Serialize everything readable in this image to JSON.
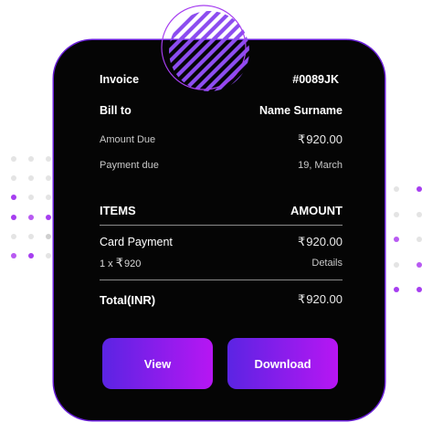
{
  "invoice": {
    "label": "Invoice",
    "number": "#0089JK",
    "bill_to_label": "Bill to",
    "bill_to_name": "Name Surname",
    "amount_due_label": "Amount Due",
    "amount_due_value": "920.00",
    "payment_due_label": "Payment due",
    "payment_due_value": "19, March"
  },
  "items": {
    "header_items": "ITEMS",
    "header_amount": "AMOUNT",
    "rows": [
      {
        "name": "Card Payment",
        "amount": "920.00",
        "qty_text": "1 x",
        "unit_price": "920",
        "details_link": "Details"
      }
    ]
  },
  "total": {
    "label": "Total(INR)",
    "value": "920.00"
  },
  "currency_symbol": "₹",
  "actions": {
    "view_label": "View",
    "download_label": "Download"
  },
  "colors": {
    "card_background": "#050505",
    "accent_purple": "#7a22e6",
    "button_gradient_start": "#5b24e3",
    "button_gradient_end": "#b716f3",
    "dot_purple": "#a63ef0",
    "dot_gray": "#d2d2d2"
  }
}
